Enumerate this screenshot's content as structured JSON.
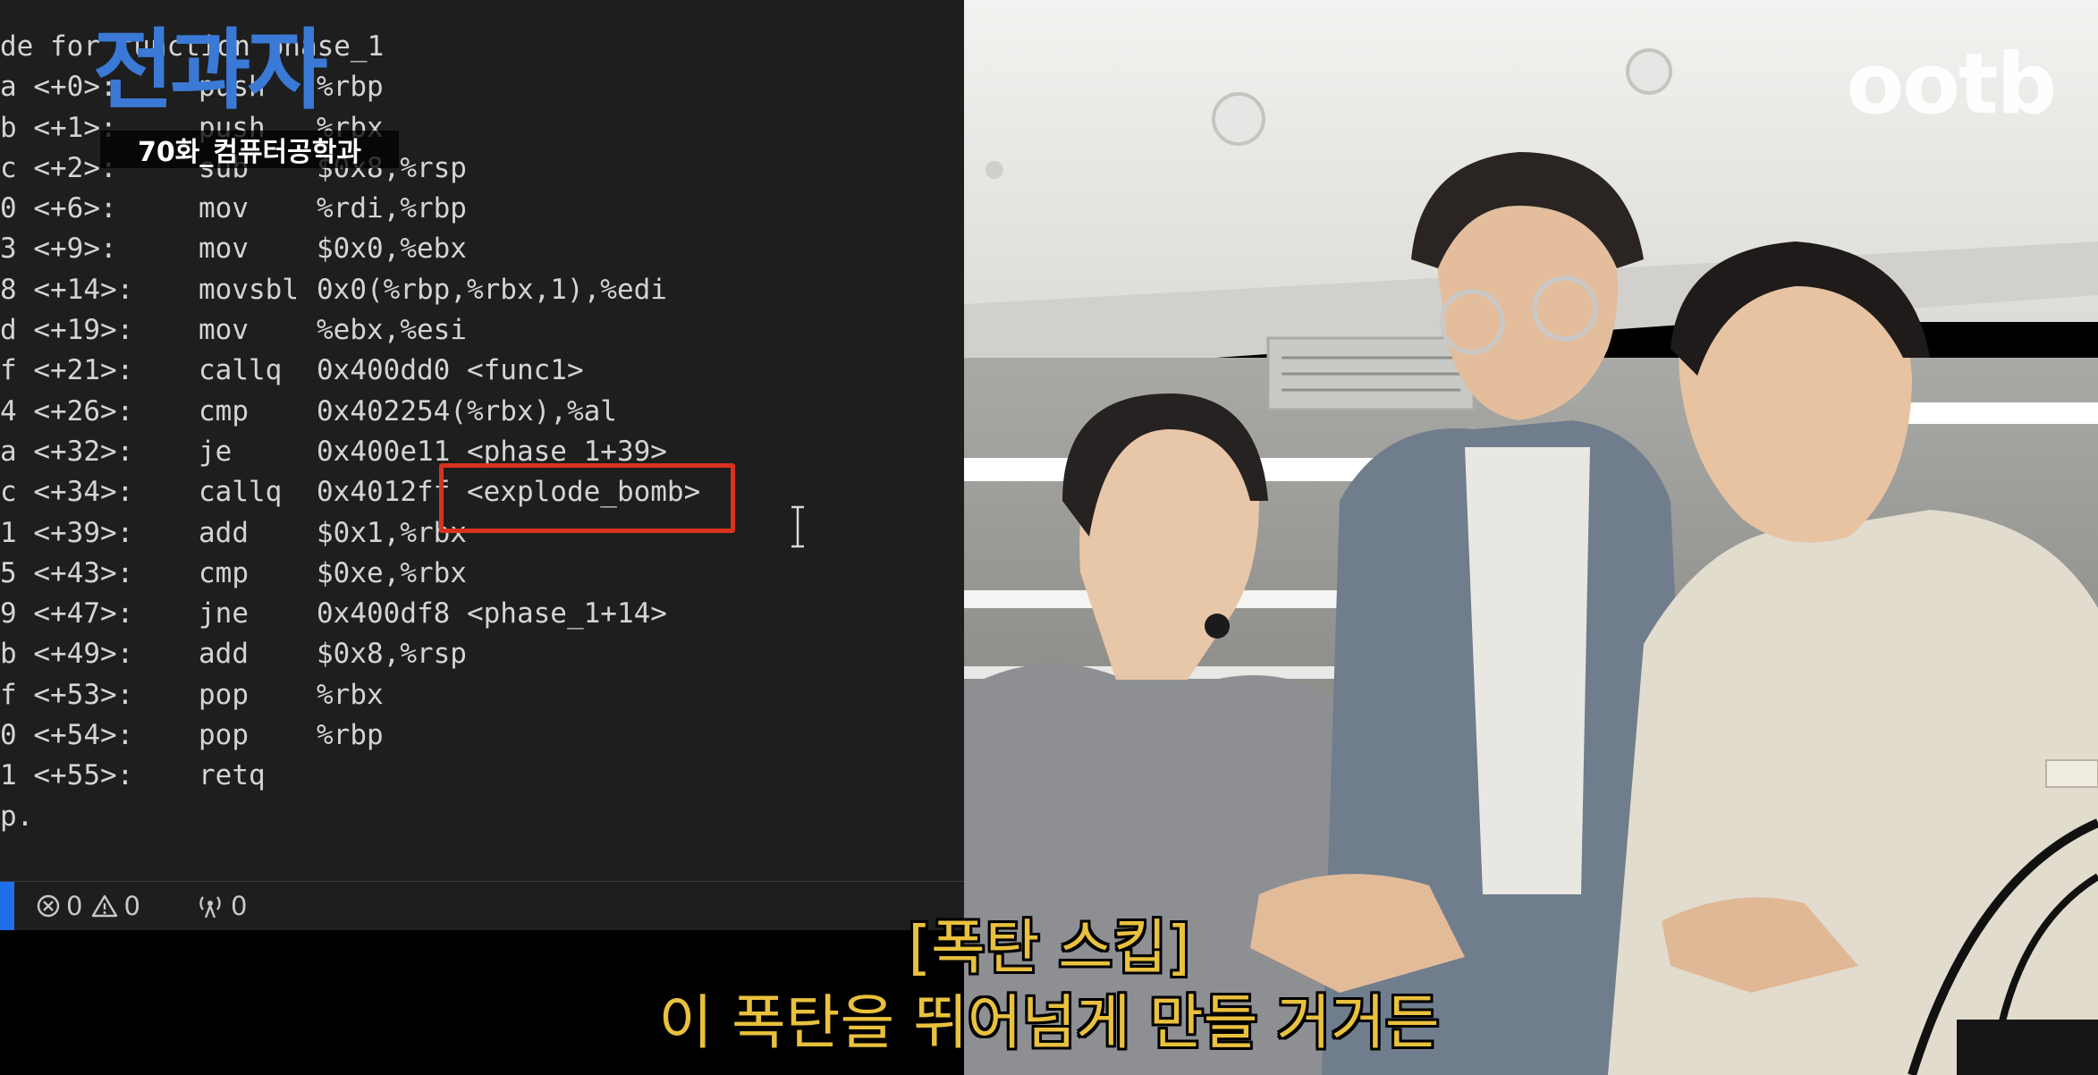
{
  "editor": {
    "code_lines": [
      {
        "addr": "de for function phase_1",
        "mnem": "",
        "ops": ""
      },
      {
        "addr": "a <+0>:",
        "mnem": "push",
        "ops": "%rbp"
      },
      {
        "addr": "b <+1>:",
        "mnem": "push",
        "ops": "%rbx"
      },
      {
        "addr": "c <+2>:",
        "mnem": "sub",
        "ops": "$0x8,%rsp"
      },
      {
        "addr": "0 <+6>:",
        "mnem": "mov",
        "ops": "%rdi,%rbp"
      },
      {
        "addr": "3 <+9>:",
        "mnem": "mov",
        "ops": "$0x0,%ebx"
      },
      {
        "addr": "8 <+14>:",
        "mnem": "movsbl",
        "ops": "0x0(%rbp,%rbx,1),%edi"
      },
      {
        "addr": "d <+19>:",
        "mnem": "mov",
        "ops": "%ebx,%esi"
      },
      {
        "addr": "f <+21>:",
        "mnem": "callq",
        "ops": "0x400dd0 <func1>"
      },
      {
        "addr": "4 <+26>:",
        "mnem": "cmp",
        "ops": "0x402254(%rbx),%al"
      },
      {
        "addr": "a <+32>:",
        "mnem": "je",
        "ops": "0x400e11 <phase_1+39>"
      },
      {
        "addr": "c <+34>:",
        "mnem": "callq",
        "ops": "0x4012ff <explode_bomb>"
      },
      {
        "addr": "1 <+39>:",
        "mnem": "add",
        "ops": "$0x1,%rbx"
      },
      {
        "addr": "5 <+43>:",
        "mnem": "cmp",
        "ops": "$0xe,%rbx"
      },
      {
        "addr": "9 <+47>:",
        "mnem": "jne",
        "ops": "0x400df8 <phase_1+14>"
      },
      {
        "addr": "b <+49>:",
        "mnem": "add",
        "ops": "$0x8,%rsp"
      },
      {
        "addr": "f <+53>:",
        "mnem": "pop",
        "ops": "%rbx"
      },
      {
        "addr": "0 <+54>:",
        "mnem": "pop",
        "ops": "%rbp"
      },
      {
        "addr": "1 <+55>:",
        "mnem": "retq",
        "ops": ""
      },
      {
        "addr": "p.",
        "mnem": "",
        "ops": ""
      }
    ],
    "status_bar": {
      "errors": "0",
      "warnings": "0",
      "ports": "0"
    }
  },
  "overlay": {
    "show_logo": "전과자",
    "episode_label": "70화_컴퓨터공학과",
    "channel_logo": "ootb"
  },
  "subtitles": {
    "line1": "[폭탄 스킵]",
    "line2": "이 폭탄을 뛰어넘게 만들 거거든"
  },
  "colors": {
    "editor_bg": "#1e1e1e",
    "highlight_box": "#d9321f",
    "subtitle": "#e9c13d",
    "logo_blue": "#3a79d6"
  }
}
